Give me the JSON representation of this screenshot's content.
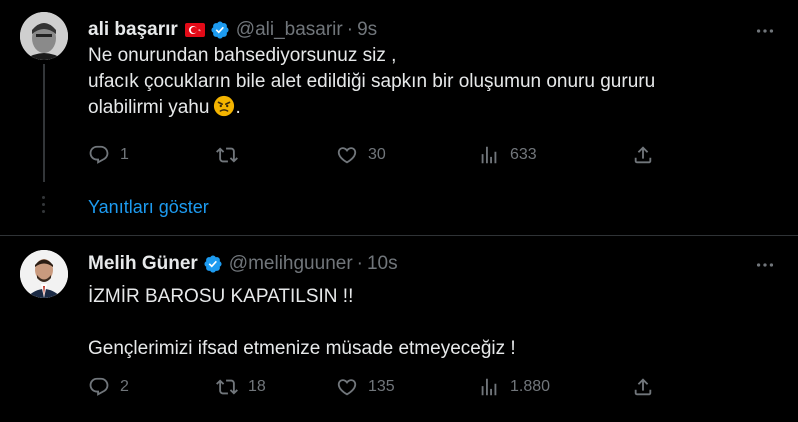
{
  "tweets": [
    {
      "name": "ali başarır",
      "handle": "@ali_basarir",
      "time": "9s",
      "lines": [
        "Ne onurundan bahsediyorsunuz siz ,",
        "ufacık çocukların bile alet edildiği sapkın bir oluşumun onuru gururu",
        "olabilirmi yahu"
      ],
      "line3_suffix": ".",
      "replies": "1",
      "retweets": "",
      "likes": "30",
      "views": "633",
      "show_replies": "Yanıtları göster"
    },
    {
      "name": "Melih Güner",
      "handle": "@melihguuner",
      "time": "10s",
      "lines": [
        "İZMİR BAROSU KAPATILSIN  !!",
        "",
        "Gençlerimizi ifsad etmenize müsade etmeyeceğiz !"
      ],
      "replies": "2",
      "retweets": "18",
      "likes": "135",
      "views": "1.880"
    }
  ],
  "separator": "·",
  "colors": {
    "background": "#000000",
    "text": "#e7e9ea",
    "muted": "#71767b",
    "accent": "#1d9bf0",
    "divider": "#2f3336"
  },
  "icons": [
    "turkey-flag-icon",
    "verified-badge-icon",
    "more-icon",
    "reply-icon",
    "retweet-icon",
    "like-icon",
    "views-icon",
    "share-icon",
    "angry-face-emoji"
  ]
}
